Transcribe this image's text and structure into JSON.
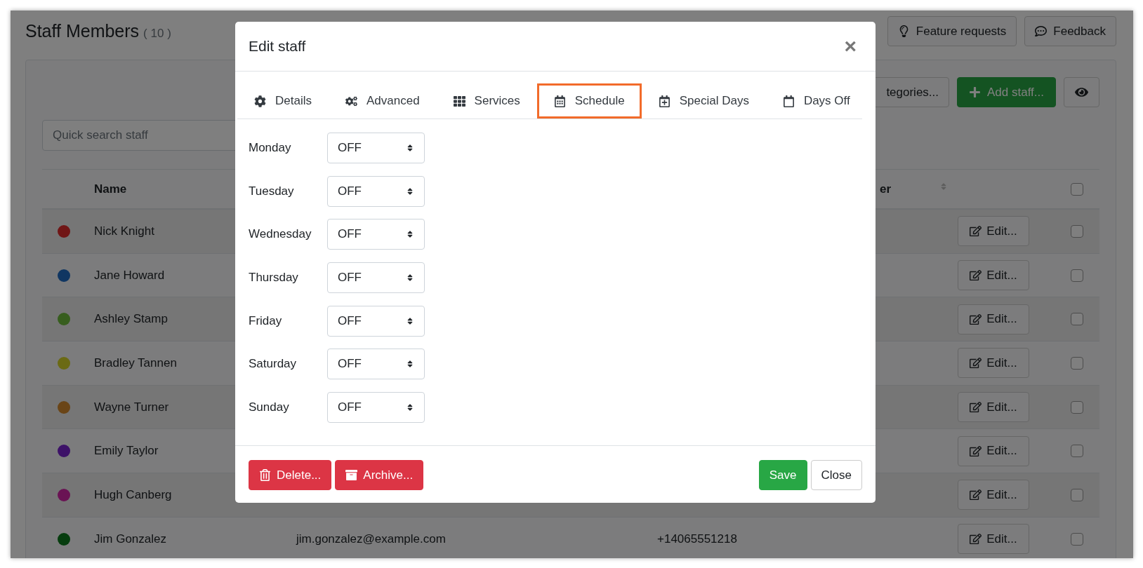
{
  "page": {
    "title": "Staff Members",
    "count": "( 10 )"
  },
  "header_buttons": [
    {
      "label": "Feature requests",
      "kind": "idea"
    },
    {
      "label": "Feedback",
      "kind": "comment"
    }
  ],
  "toolbar": {
    "categories_button": "tegories...",
    "add_button": "Add staff..."
  },
  "search": {
    "placeholder": "Quick search staff"
  },
  "table": {
    "columns": [
      {
        "label": "Name"
      },
      {
        "label": "er",
        "sortable": true
      }
    ],
    "header_checkbox": {
      "checked": false
    },
    "rows": [
      {
        "color": "#701616",
        "name": "Nick Knight",
        "action": "Edit...",
        "checked": false
      },
      {
        "color": "#103662",
        "name": "Jane Howard",
        "action": "Edit...",
        "checked": false
      },
      {
        "color": "#375e1e",
        "name": "Ashley Stamp",
        "action": "Edit...",
        "checked": false
      },
      {
        "color": "#6b6a14",
        "name": "Bradley Tannen",
        "action": "Edit...",
        "checked": false
      },
      {
        "color": "#6a4517",
        "name": "Wayne Turner",
        "action": "Edit...",
        "checked": false
      },
      {
        "color": "#3d1268",
        "name": "Emily Taylor",
        "action": "Edit...",
        "checked": false
      },
      {
        "color": "#6a1354",
        "name": "Hugh Canberg",
        "action": "Edit...",
        "checked": false
      },
      {
        "color": "#063d0e",
        "name": "Jim Gonzalez",
        "email": "jim.gonzalez@example.com",
        "phone": "+14065551218",
        "action": "Edit...",
        "checked": false
      }
    ]
  },
  "modal": {
    "title": "Edit staff",
    "close": "×",
    "tabs": [
      {
        "label": "Details",
        "kind": "gear",
        "selected": false
      },
      {
        "label": "Advanced",
        "kind": "gears",
        "selected": false
      },
      {
        "label": "Services",
        "kind": "grid",
        "selected": false
      },
      {
        "label": "Schedule",
        "kind": "calendar",
        "selected": true
      },
      {
        "label": "Special Days",
        "kind": "calendar-plus",
        "selected": false
      },
      {
        "label": "Days Off",
        "kind": "calendar-blank",
        "selected": false
      }
    ],
    "days": [
      {
        "label": "Monday",
        "value": "OFF"
      },
      {
        "label": "Tuesday",
        "value": "OFF"
      },
      {
        "label": "Wednesday",
        "value": "OFF"
      },
      {
        "label": "Thursday",
        "value": "OFF"
      },
      {
        "label": "Friday",
        "value": "OFF"
      },
      {
        "label": "Saturday",
        "value": "OFF"
      },
      {
        "label": "Sunday",
        "value": "OFF"
      }
    ],
    "footer": {
      "delete": "Delete...",
      "archive": "Archive...",
      "save": "Save",
      "close": "Close"
    }
  }
}
